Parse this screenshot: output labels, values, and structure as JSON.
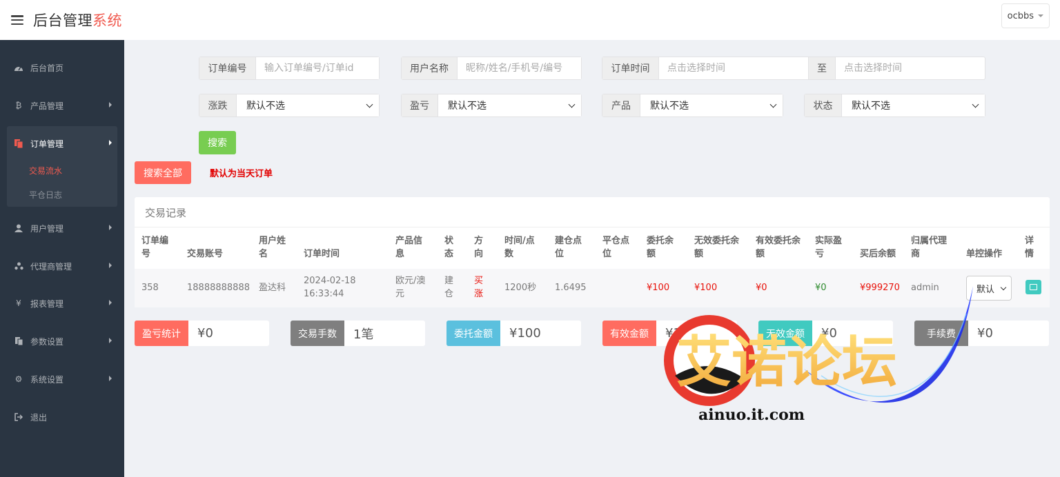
{
  "header": {
    "brand_main": "后台管理",
    "brand_accent": "系统",
    "user": "ocbbs"
  },
  "colors": {
    "accent": "#f05a4f",
    "sidebar_bg": "#2a3542",
    "green": "#78cd51",
    "red": "#ff6c60",
    "cyan": "#5bc0de",
    "teal": "#41cac0",
    "gray": "#7f7f7f"
  },
  "sidebar": {
    "items": [
      {
        "label": "后台首页",
        "icon": "dashboard-icon"
      },
      {
        "label": "产品管理",
        "icon": "bitcoin-icon"
      },
      {
        "label": "订单管理",
        "icon": "copy-icon"
      },
      {
        "label": "用户管理",
        "icon": "user-icon"
      },
      {
        "label": "代理商管理",
        "icon": "sitemap-icon"
      },
      {
        "label": "报表管理",
        "icon": "yen-icon"
      },
      {
        "label": "参数设置",
        "icon": "files-icon"
      },
      {
        "label": "系统设置",
        "icon": "cogs-icon"
      },
      {
        "label": "退出",
        "icon": "sign-out-icon"
      }
    ],
    "sub_items": [
      {
        "label": "交易流水"
      },
      {
        "label": "平仓日志"
      }
    ]
  },
  "filters": {
    "order_no": {
      "label": "订单编号",
      "placeholder": "输入订单编号/订单id"
    },
    "user_name": {
      "label": "用户名称",
      "placeholder": "昵称/姓名/手机号/编号"
    },
    "order_time": {
      "label": "订单时间",
      "placeholder": "点击选择时间",
      "to_label": "至",
      "to_placeholder": "点击选择时间"
    },
    "rise_fall": {
      "label": "涨跌",
      "value": "默认不选"
    },
    "profit_loss": {
      "label": "盈亏",
      "value": "默认不选"
    },
    "product": {
      "label": "产品",
      "value": "默认不选"
    },
    "status": {
      "label": "状态",
      "value": "默认不选"
    },
    "search_button": "搜索",
    "search_all_button": "搜索全部",
    "hint": "默认为当天订单"
  },
  "panel": {
    "title": "交易记录",
    "headers": [
      "订单编号",
      "交易账号",
      "用户姓名",
      "订单时间",
      "产品信息",
      "状态",
      "方向",
      "时间/点数",
      "建仓点位",
      "平仓点位",
      "委托余额",
      "无效委托余额",
      "有效委托余额",
      "实际盈亏",
      "买后余额",
      "归属代理商",
      "单控操作",
      "详情"
    ],
    "rows": [
      {
        "order_no": "358",
        "account": "18888888888",
        "user_name": "盈达科",
        "order_time": "2024-02-18 16:33:44",
        "product": "欧元/澳元",
        "status": "建仓",
        "direction": "买涨",
        "time_points": "1200秒",
        "open_price": "1.6495",
        "close_price": "",
        "entrust_balance": "¥100",
        "invalid_entrust": "¥100",
        "valid_entrust": "¥0",
        "actual_pl": "¥0",
        "balance_after": "¥999270",
        "agent": "admin",
        "control_value": "默认"
      }
    ]
  },
  "stats": [
    {
      "label": "盈亏统计",
      "value": "¥0",
      "color": "#ff6c60"
    },
    {
      "label": "交易手数",
      "value": "1笔",
      "color": "#7f7f7f"
    },
    {
      "label": "委托金额",
      "value": "¥100",
      "color": "#5bc0de"
    },
    {
      "label": "有效金额",
      "value": "¥100",
      "color": "#ff6c60"
    },
    {
      "label": "无效金额",
      "value": "¥0",
      "color": "#41cac0"
    },
    {
      "label": "手续费",
      "value": "¥0",
      "color": "#7f7f7f"
    }
  ],
  "watermark": {
    "title": "艾诺论坛",
    "url": "ainuo.it.com"
  }
}
